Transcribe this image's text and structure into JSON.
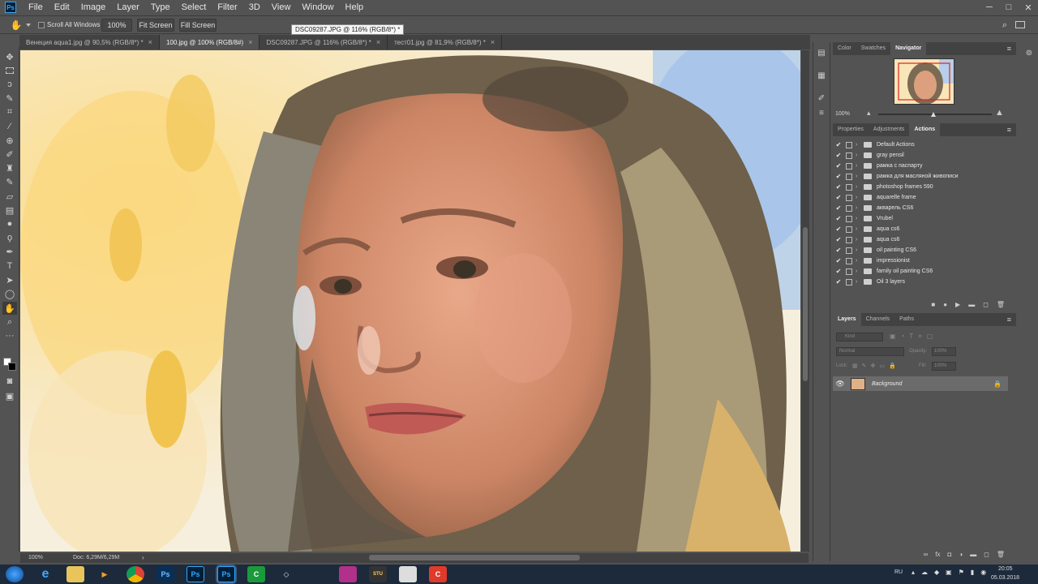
{
  "app": {
    "logo_text": "Ps"
  },
  "menu": [
    "File",
    "Edit",
    "Image",
    "Layer",
    "Type",
    "Select",
    "Filter",
    "3D",
    "View",
    "Window",
    "Help"
  ],
  "window_controls": {
    "minimize": "─",
    "maximize": "□",
    "close": "✕"
  },
  "options_bar": {
    "scroll_all_windows": "Scroll All Windows",
    "zoom_value": "100%",
    "fit_screen": "Fit Screen",
    "fill_screen": "Fill Screen"
  },
  "tooltip": "DSC09287.JPG @ 116% (RGB/8*) *",
  "tabs": [
    {
      "label": "Венеция aqua1.jpg @ 90,5% (RGB/8*) *",
      "close": "×"
    },
    {
      "label": "100.jpg @ 100% (RGB/8#)",
      "close": "×"
    },
    {
      "label": "DSC09287.JPG @ 116% (RGB/8*) *",
      "close": "×"
    },
    {
      "label": "тест01.jpg @ 81,9% (RGB/8*) *",
      "close": "×"
    }
  ],
  "tools": [
    "move-icon",
    "marquee-icon",
    "lasso-icon",
    "quick-select-icon",
    "crop-icon",
    "eyedropper-icon",
    "healing-icon",
    "brush-icon",
    "clone-stamp-icon",
    "history-brush-icon",
    "eraser-icon",
    "gradient-icon",
    "blur-icon",
    "dodge-icon",
    "pen-icon",
    "type-icon",
    "path-select-icon",
    "shape-icon",
    "hand-icon",
    "zoom-icon",
    "more-tools-icon"
  ],
  "navigator": {
    "tabs": [
      "Color",
      "Swatches",
      "Navigator"
    ],
    "active": "Navigator",
    "zoom": "100%"
  },
  "actions_panel": {
    "tabs": [
      "Properties",
      "Adjustments",
      "Actions"
    ],
    "active": "Actions",
    "items": [
      {
        "name": "Default Actions",
        "checked": true
      },
      {
        "name": "gray pensil",
        "checked": true
      },
      {
        "name": "рамка с паспарту",
        "checked": true
      },
      {
        "name": "рамка для масляной живописи",
        "checked": true
      },
      {
        "name": "photoshop frames 590",
        "checked": true
      },
      {
        "name": "aquarelle frame",
        "checked": true
      },
      {
        "name": "акварель CS6",
        "checked": true
      },
      {
        "name": "Vrubel",
        "checked": true
      },
      {
        "name": "aqua cs6",
        "checked": true
      },
      {
        "name": "aqua cs6",
        "checked": true
      },
      {
        "name": "oil painting CS6",
        "checked": true
      },
      {
        "name": "impressionist",
        "checked": true
      },
      {
        "name": "family oil painting CS6",
        "checked": true
      },
      {
        "name": "Oil 3 layers",
        "checked": true
      }
    ]
  },
  "layers_panel": {
    "tabs": [
      "Layers",
      "Channels",
      "Paths"
    ],
    "active": "Layers",
    "kind_placeholder": "Kind",
    "blend_mode": "Normal",
    "opacity_label": "Opacity:",
    "opacity_value": "100%",
    "lock_label": "Lock:",
    "fill_label": "Fill:",
    "fill_value": "100%",
    "layers": [
      {
        "name": "Background"
      }
    ]
  },
  "status": {
    "zoom": "100%",
    "doc": "Doc: 6,29M/6,29M"
  },
  "taskbar": {
    "apps": [
      "start",
      "ie",
      "explorer",
      "media",
      "chrome",
      "ps-cs6",
      "ps-cc",
      "ps-active",
      "corel",
      "inkscape",
      "app-pink",
      "app-studio",
      "app-notepad",
      "app-red"
    ],
    "lang": "RU",
    "time": "20:05",
    "date": "05.03.2018"
  },
  "colors": {
    "ui_bg": "#535353",
    "panel_dark": "#424242",
    "accent": "#31a8ff",
    "taskbar": "#1c2a3b"
  }
}
